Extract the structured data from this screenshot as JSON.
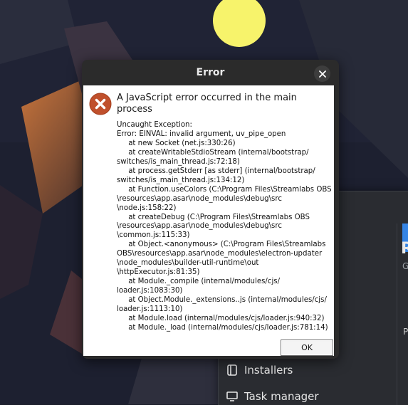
{
  "dialog": {
    "title": "Error",
    "close_icon": "close-icon",
    "headline": "A JavaScript error occurred in the main process",
    "details": "Uncaught Exception:\nError: EINVAL: invalid argument, uv_pipe_open\n     at new Socket (net.js:330:26)\n     at createWritableStdioStream (internal/bootstrap/\nswitches/is_main_thread.js:72:18)\n     at process.getStderr [as stderr] (internal/bootstrap/\nswitches/is_main_thread.js:134:12)\n     at Function.useColors (C:\\Program Files\\Streamlabs OBS\n\\resources\\app.asar\\node_modules\\debug\\src\n\\node.js:158:22)\n     at createDebug (C:\\Program Files\\Streamlabs OBS\n\\resources\\app.asar\\node_modules\\debug\\src\n\\common.js:115:33)\n     at Object.<anonymous> (C:\\Program Files\\Streamlabs\nOBS\\resources\\app.asar\\node_modules\\electron-updater\n\\node_modules\\builder-util-runtime\\out\n\\httpExecutor.js:81:35)\n     at Module._compile (internal/modules/cjs/\nloader.js:1083:30)\n     at Object.Module._extensions..js (internal/modules/cjs/\nloader.js:1113:10)\n     at Module.load (internal/modules/cjs/loader.js:940:32)\n     at Module._load (internal/modules/cjs/loader.js:781:14)",
    "ok_label": "OK",
    "error_icon": "error-icon"
  },
  "background_app": {
    "sidebar_items": [
      {
        "label": "Installers",
        "icon": "package-icon"
      },
      {
        "label": "Task manager",
        "icon": "monitor-icon"
      }
    ],
    "clipped_heading": "R",
    "clipped_subtext": "G",
    "clipped_label": "P"
  },
  "colors": {
    "accent": "#3584e4",
    "error_icon_bg": "#c0502c",
    "desktop_bg": "#1b1e2a"
  }
}
